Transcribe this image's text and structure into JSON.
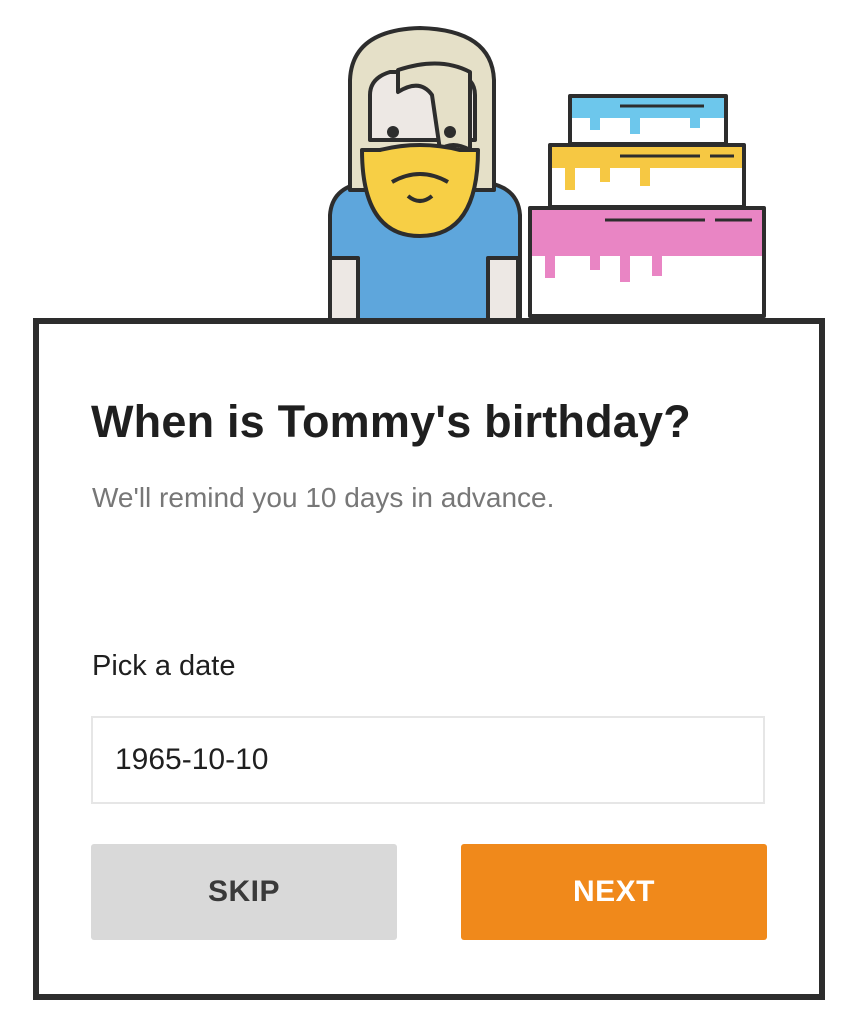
{
  "illustration": {
    "character_icon": "bearded-person-icon",
    "cake_icon": "layered-birthday-cake-icon"
  },
  "dialog": {
    "title": "When is Tommy's birthday?",
    "subtitle": "We'll remind you 10 days in advance.",
    "date_field": {
      "label": "Pick a date",
      "value": "1965-10-10"
    },
    "buttons": {
      "skip_label": "SKIP",
      "next_label": "NEXT"
    }
  },
  "colors": {
    "accent": "#f0891b",
    "skip_button": "#d9d9d9",
    "frame": "#2d2d2d",
    "shirt": "#5ea6dc",
    "beard": "#f7cf45",
    "hair": "#e5e0c8",
    "frosting_top": "#6dc7ec",
    "frosting_middle": "#f6c843",
    "frosting_bottom": "#e985c4"
  }
}
